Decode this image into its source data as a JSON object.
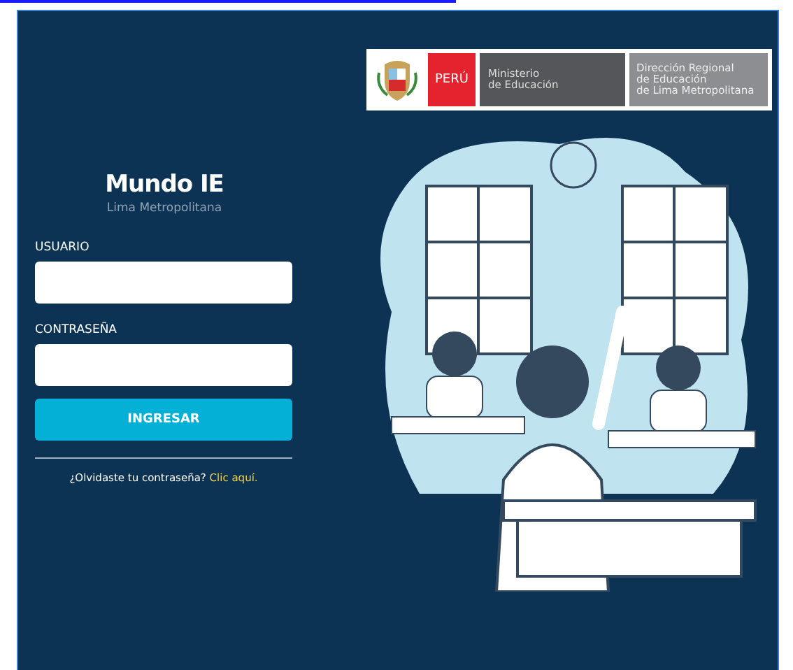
{
  "banner": {
    "country": "PERÚ",
    "ministry": "Ministerio\nde Educación",
    "regional": "Dirección Regional\nde Educación\nde Lima Metropolitana"
  },
  "login": {
    "title": "Mundo IE",
    "subtitle": "Lima Metropolitana",
    "fields": [
      {
        "label": "USUARIO"
      },
      {
        "label": "CONTRASEÑA"
      }
    ],
    "submit": "INGRESAR",
    "forgot": {
      "text": "¿Olvidaste tu contraseña?",
      "link": "Clic aquí."
    }
  }
}
